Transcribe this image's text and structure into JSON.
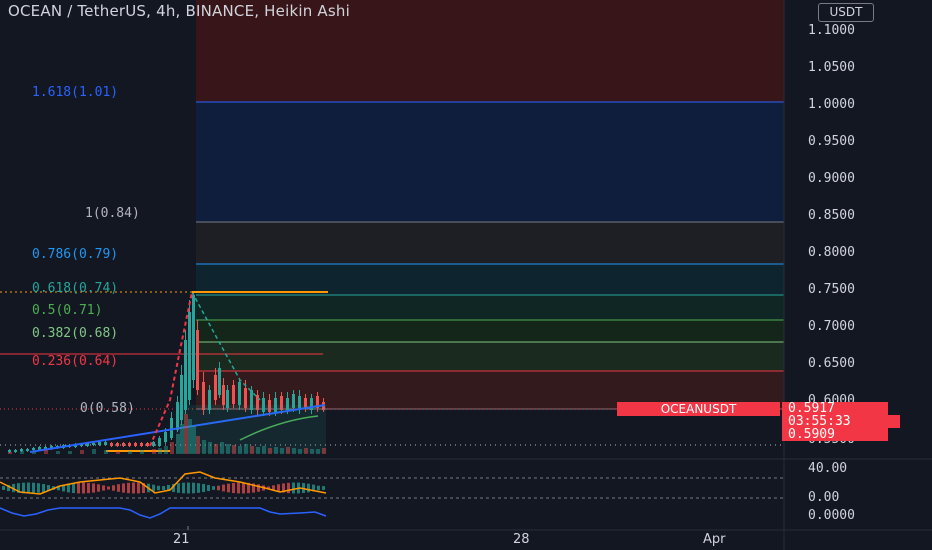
{
  "header": {
    "title": "OCEAN / TetherUS, 4h, BINANCE, Heikin Ashi",
    "currency_button": "USDT"
  },
  "price_axis": {
    "labels": [
      "1.1000",
      "1.0500",
      "1.0000",
      "0.9500",
      "0.9000",
      "0.8500",
      "0.8000",
      "0.7500",
      "0.7000",
      "0.6500",
      "0.6000",
      "0.5500"
    ]
  },
  "fib_levels": [
    {
      "label": "1.618(1.01)",
      "value": 1.01,
      "color": "#2962ff"
    },
    {
      "label": "1(0.84)",
      "value": 0.84,
      "color": "#787b86"
    },
    {
      "label": "0.786(0.79)",
      "value": 0.79,
      "color": "#2196f3"
    },
    {
      "label": "0.618(0.74)",
      "value": 0.74,
      "color": "#26a69a"
    },
    {
      "label": "0.5(0.71)",
      "value": 0.71,
      "color": "#4caf50"
    },
    {
      "label": "0.382(0.68)",
      "value": 0.68,
      "color": "#81c784"
    },
    {
      "label": "0.236(0.64)",
      "value": 0.64,
      "color": "#f23645"
    },
    {
      "label": "0(0.58)",
      "value": 0.58,
      "color": "#787b86"
    }
  ],
  "symbol_tag": "OCEANUSDT",
  "last_price": {
    "price": "0.5917",
    "countdown": "03:55:33",
    "secondary": "0.5909"
  },
  "oscillator_axis": {
    "labels": [
      "40.00",
      "0.00",
      "0.0000"
    ]
  },
  "time_axis": {
    "labels": [
      "21",
      "28",
      "Apr"
    ]
  },
  "colors": {
    "background": "#131722",
    "up": "#26a69a",
    "down": "#ef5350",
    "accent_red": "#f23645"
  }
}
